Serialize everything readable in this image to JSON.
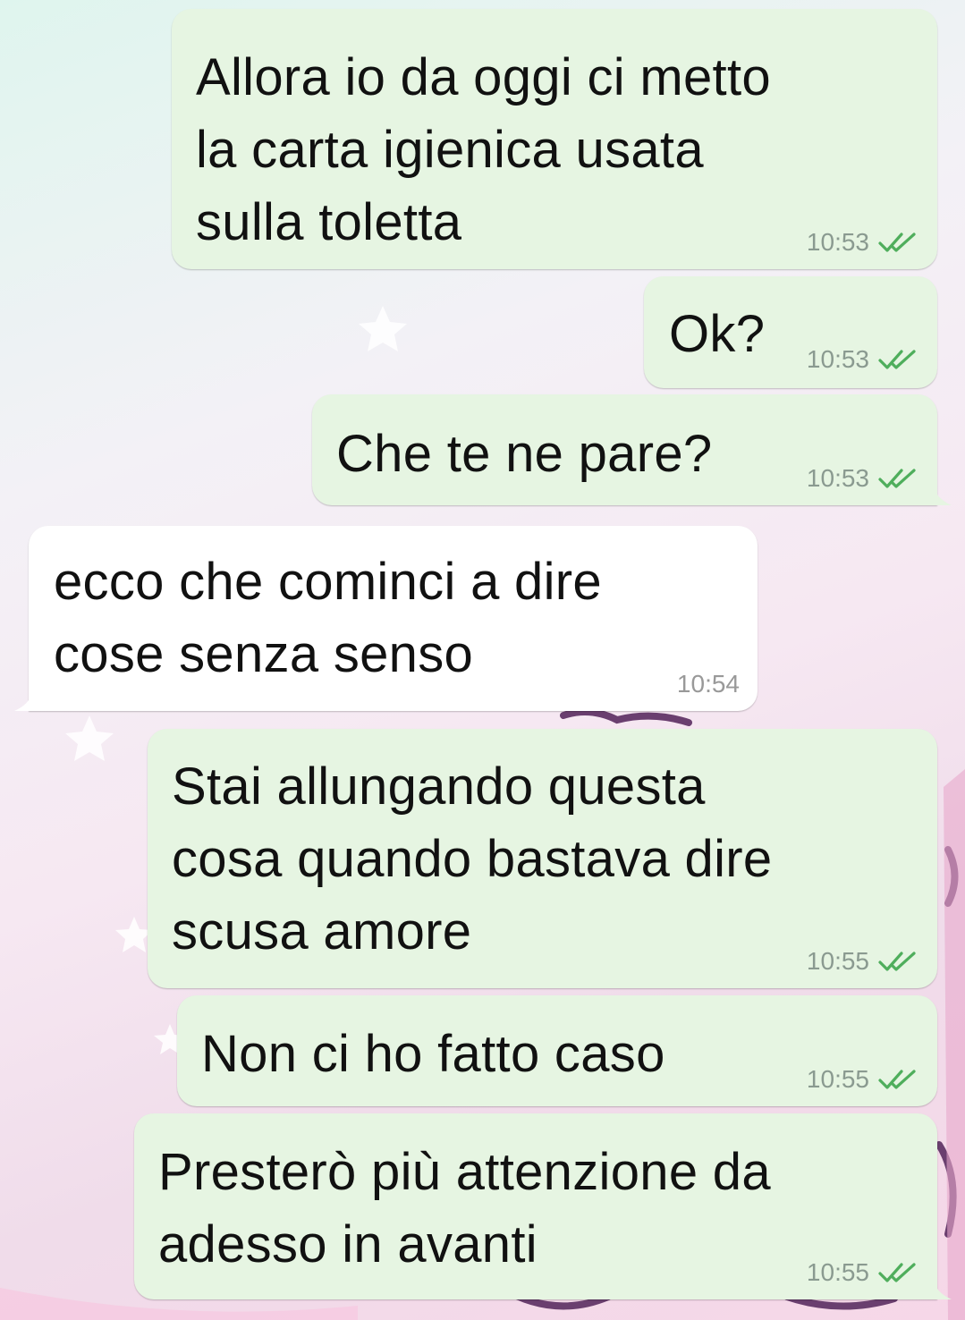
{
  "messages": [
    {
      "text_lines": [
        "Allora io da oggi ci metto",
        "la carta igienica usata",
        "sulla toletta"
      ],
      "time": "10:53"
    },
    {
      "text_lines": [
        "Ok?"
      ],
      "time": "10:53"
    },
    {
      "text_lines": [
        "Che te ne pare?"
      ],
      "time": "10:53"
    },
    {
      "text_lines": [
        "ecco che cominci a dire",
        "cose senza senso"
      ],
      "time": "10:54"
    },
    {
      "text_lines": [
        "Stai allungando questa",
        "cosa quando bastava dire",
        "scusa amore"
      ],
      "time": "10:55"
    },
    {
      "text_lines": [
        "Non ci ho fatto caso"
      ],
      "time": "10:55"
    },
    {
      "text_lines": [
        "Presterò più attenzione da",
        "adesso in avanti"
      ],
      "time": "10:55"
    }
  ],
  "status_icon": "double-check-icon",
  "colors": {
    "outgoing_bubble": "#e6f5e2",
    "incoming_bubble": "#ffffff",
    "read_tick": "#4fae5c",
    "time_text": "#8a9a90"
  }
}
